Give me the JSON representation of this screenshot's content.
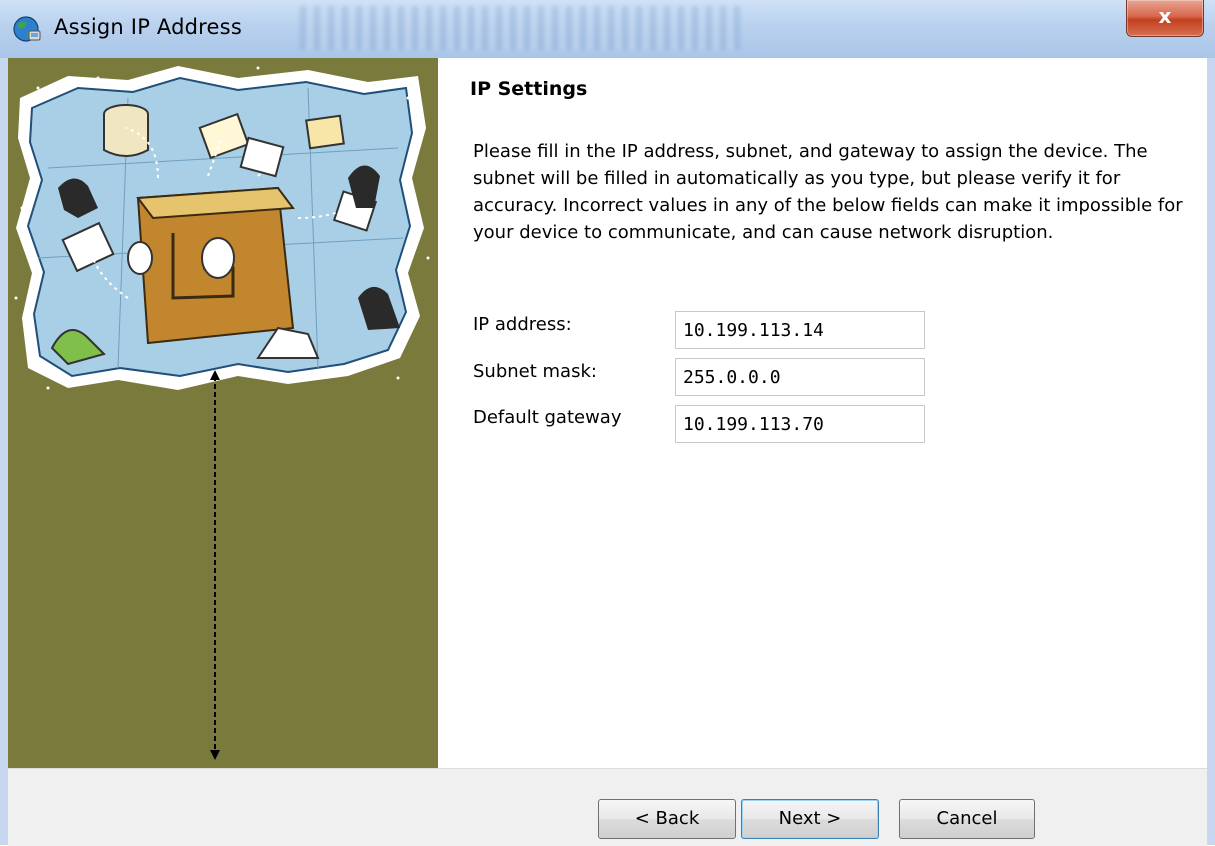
{
  "window": {
    "title": "Assign IP Address",
    "close_label": "x"
  },
  "page": {
    "title": "IP Settings",
    "description": "Please fill in the IP address, subnet, and gateway to assign the device. The subnet will be filled in automatically as you type, but please verify it for accuracy.  Incorrect values in any of the below fields can make it impossible for your device to communicate, and can cause network disruption."
  },
  "form": {
    "ip_address": {
      "label": "IP address:",
      "value": "10.199.113.14"
    },
    "subnet_mask": {
      "label": "Subnet mask:",
      "value": "255.0.0.0"
    },
    "default_gateway": {
      "label": "Default gateway",
      "value": "10.199.113.70"
    }
  },
  "buttons": {
    "back": "< Back",
    "next": "Next >",
    "cancel": "Cancel"
  },
  "colors": {
    "side_panel": "#7a7a3c",
    "titlebar": "#b9d1ee",
    "close_button": "#c2401f"
  },
  "icons": {
    "app": "globe-network-icon",
    "illustration": "network-collage-illustration"
  }
}
